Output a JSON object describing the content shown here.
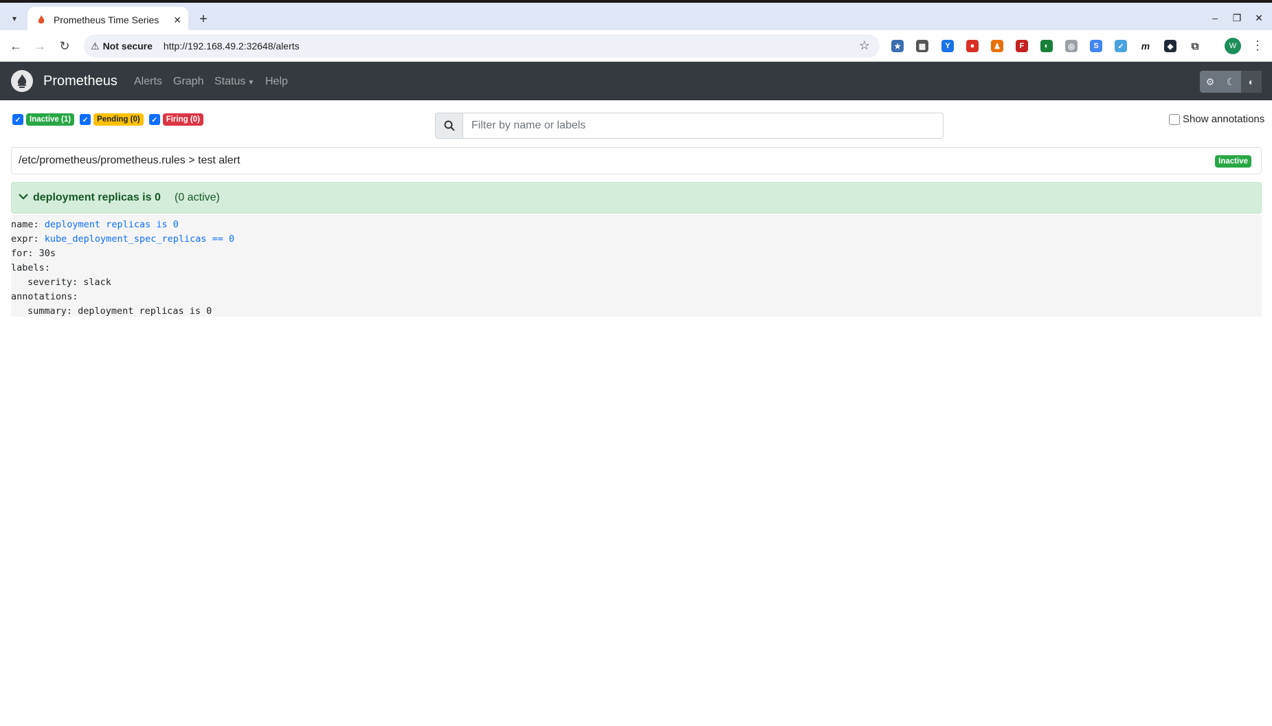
{
  "browser": {
    "tab_title": "Prometheus Time Series",
    "security_label": "Not secure",
    "url": "http://192.168.49.2:32648/alerts",
    "profile_initial": "W"
  },
  "navbar": {
    "brand": "Prometheus",
    "links": [
      "Alerts",
      "Graph",
      "Status",
      "Help"
    ]
  },
  "filters": {
    "inactive": "Inactive (1)",
    "pending": "Pending (0)",
    "firing": "Firing (0)"
  },
  "search": {
    "placeholder": "Filter by name or labels"
  },
  "show_annotations_label": "Show annotations",
  "group": {
    "path": "/etc/prometheus/prometheus.rules > test alert",
    "state": "Inactive"
  },
  "rule": {
    "name": "deployment replicas is 0",
    "active_count": "(0 active)",
    "details": {
      "name_key": "name:",
      "name_value": "deployment replicas is 0",
      "expr_key": "expr:",
      "expr_value": "kube_deployment_spec_replicas == 0",
      "for_line": "for: 30s",
      "labels_key": "labels:",
      "severity_line": "severity: slack",
      "annotations_key": "annotations:",
      "summary_line": "summary: deployment replicas is 0"
    }
  }
}
